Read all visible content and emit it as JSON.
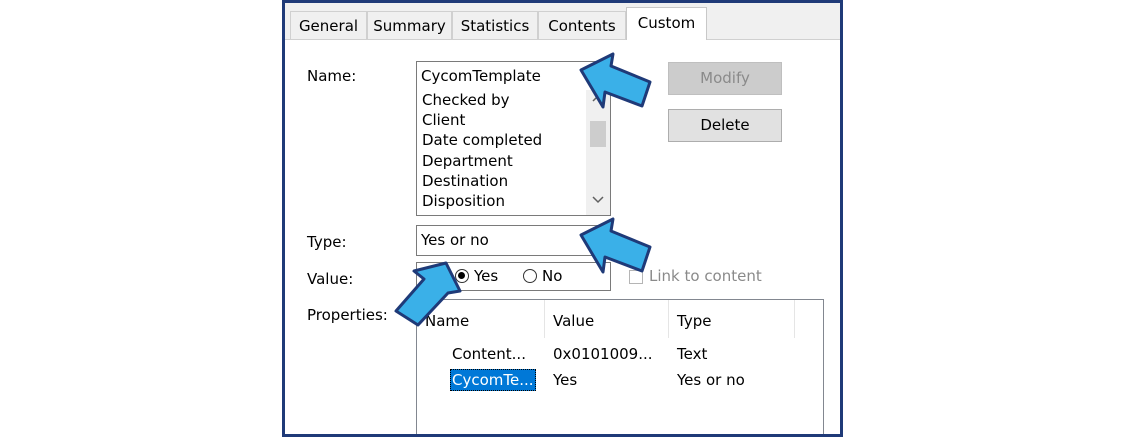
{
  "tabs": [
    {
      "label": "General"
    },
    {
      "label": "Summary"
    },
    {
      "label": "Statistics"
    },
    {
      "label": "Contents"
    },
    {
      "label": "Custom"
    }
  ],
  "name_label": "Name:",
  "name_value": "CycomTemplate",
  "name_list": [
    "Checked by",
    "Client",
    "Date completed",
    "Department",
    "Destination",
    "Disposition"
  ],
  "modify_label": "Modify",
  "delete_label": "Delete",
  "type_label": "Type:",
  "type_value": "Yes or no",
  "value_label": "Value:",
  "yes_label": "Yes",
  "no_label": "No",
  "yes_selected": true,
  "link_label": "Link to content",
  "link_checked": false,
  "properties_label": "Properties:",
  "columns": [
    "Name",
    "Value",
    "Type"
  ],
  "rows": [
    {
      "name": "Content...",
      "value": "0x0101009...",
      "type": "Text",
      "selected": false
    },
    {
      "name": "CycomTe...",
      "value": "Yes",
      "type": "Yes or no",
      "selected": true
    }
  ],
  "colors": {
    "frame": "#1f3a78",
    "arrow_fill": "#3ab0e8",
    "selection": "#0078d7"
  },
  "icons": [
    "up-arrow-icon",
    "down-arrow-icon",
    "callout-arrow-icon"
  ]
}
